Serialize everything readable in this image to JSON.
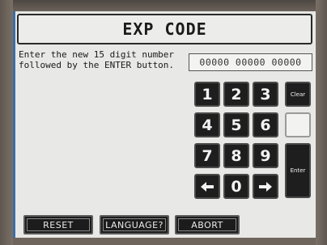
{
  "screen": {
    "title": "EXP CODE",
    "instruction_line1": "Enter the new 15 digit number",
    "instruction_line2": "followed by the ENTER button.",
    "code_value": "00000 00000 00000"
  },
  "keypad": {
    "k1": "1",
    "k2": "2",
    "k3": "3",
    "k4": "4",
    "k5": "5",
    "k6": "6",
    "k7": "7",
    "k8": "8",
    "k9": "9",
    "k0": "0",
    "clear": "Clear",
    "enter": "Enter",
    "left_icon": "arrow-left-icon",
    "right_icon": "arrow-right-icon"
  },
  "bottom_bar": {
    "reset": "RESET",
    "language": "LANGUAGE?",
    "abort": "ABORT"
  },
  "colors": {
    "screen_bg": "#e8e8e6",
    "key_bg": "#1e1e1e",
    "bezel": "#6f655c"
  }
}
